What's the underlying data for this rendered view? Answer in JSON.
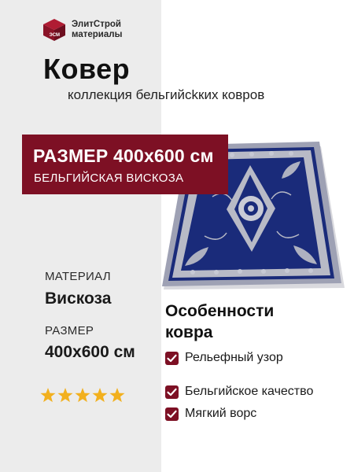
{
  "brand": {
    "logo_text": "ЭлитСтрой\nматериалы",
    "logo_mark_text": "ЭСМ",
    "accent_color": "#7d1024"
  },
  "product": {
    "title": "Ковер",
    "subtitle": "коллекция бельгийсkких ковров"
  },
  "banner": {
    "size_text": "РАЗМЕР 400x600 см",
    "material_text": "БЕЛЬГИЙСКАЯ ВИСКОЗА"
  },
  "specs": {
    "material_label": "МАТЕРИАЛ",
    "material_value": "Вискоза",
    "size_label": "РАЗМЕР",
    "size_value": "400x600 см"
  },
  "rating": {
    "stars": 5,
    "max": 5,
    "star_color": "#f2b01e"
  },
  "features": {
    "title": "Особенности\nковра",
    "items": [
      {
        "label": "Рельефный узор"
      },
      {
        "label": "Бельгийское качество"
      },
      {
        "label": "Мягкий ворс"
      }
    ],
    "check_icon": "check-icon"
  },
  "carpet_colors": {
    "field": "#1a2b7a",
    "ornament": "#b8bac6",
    "border_dark": "#16246a"
  }
}
